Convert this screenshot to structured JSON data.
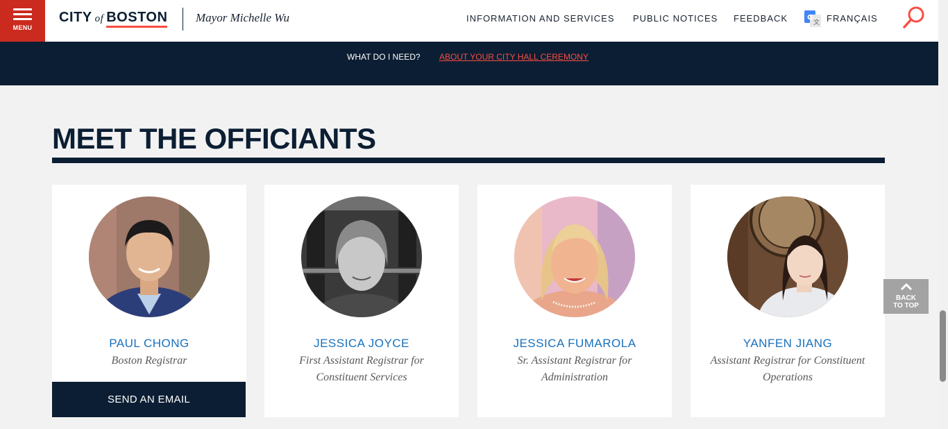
{
  "header": {
    "menu_label": "MENU",
    "logo": {
      "city": "CITY",
      "of": "of",
      "boston": "BOSTON"
    },
    "mayor": "Mayor Michelle Wu",
    "nav": [
      {
        "label": "INFORMATION AND SERVICES"
      },
      {
        "label": "PUBLIC NOTICES"
      },
      {
        "label": "FEEDBACK"
      },
      {
        "label": "FRANÇAIS",
        "icon": "translate-icon"
      }
    ],
    "search_icon": "search-icon"
  },
  "subnav": {
    "items": [
      {
        "label": "WHAT DO I NEED?"
      },
      {
        "label": "ABOUT YOUR CITY HALL CEREMONY",
        "active": true
      }
    ]
  },
  "section": {
    "title": "MEET THE OFFICIANTS"
  },
  "officiants": [
    {
      "name": "PAUL CHONG",
      "role": "Boston Registrar",
      "button": "SEND AN EMAIL"
    },
    {
      "name": "JESSICA JOYCE",
      "role": "First Assistant Registrar for Constituent Services"
    },
    {
      "name": "JESSICA FUMAROLA",
      "role": "Sr. Assistant Registrar for Administration"
    },
    {
      "name": "YANFEN JIANG",
      "role": "Assistant Registrar for Constituent Operations"
    }
  ],
  "back_to_top": {
    "line1": "BACK",
    "line2": "TO TOP"
  },
  "colors": {
    "navy": "#0c1e33",
    "red": "#cb2a1f",
    "accent_red": "#fb4d42",
    "link_blue": "#1871bd",
    "background": "#f2f2f2"
  }
}
